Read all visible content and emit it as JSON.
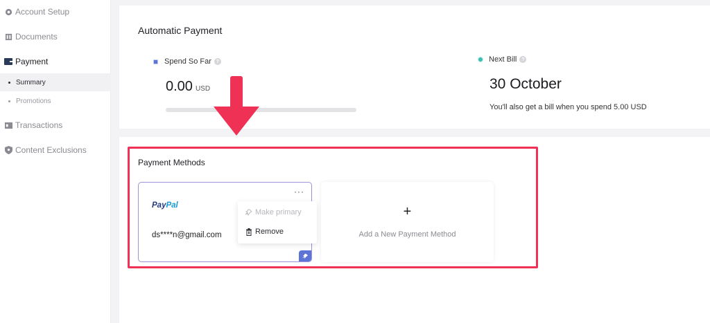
{
  "sidebar": {
    "items": [
      {
        "label": "Account Setup",
        "icon": "gear-icon"
      },
      {
        "label": "Documents",
        "icon": "document-icon"
      },
      {
        "label": "Payment",
        "icon": "wallet-icon"
      },
      {
        "label": "Transactions",
        "icon": "transactions-icon"
      },
      {
        "label": "Content Exclusions",
        "icon": "shield-icon"
      }
    ],
    "payment_sub": [
      {
        "label": "Summary"
      },
      {
        "label": "Promotions"
      }
    ],
    "active_item": "Payment",
    "active_sub": "Summary"
  },
  "automatic_payment": {
    "title": "Automatic Payment",
    "spend": {
      "label": "Spend So Far",
      "value": "0.00",
      "currency": "USD",
      "progress_fraction": 0
    },
    "next_bill": {
      "label": "Next Bill",
      "date": "30 October",
      "note": "You'll also get a bill when you spend 5.00 USD"
    }
  },
  "payment_methods": {
    "title": "Payment Methods",
    "paypal": {
      "brand_part1": "Pay",
      "brand_part2": "Pal",
      "email": "ds****n@gmail.com",
      "more_label": "···"
    },
    "menu": {
      "make_primary": "Make primary",
      "remove": "Remove"
    },
    "add_new": {
      "plus": "+",
      "label": "Add a New Payment Method"
    }
  },
  "colors": {
    "highlight": "#ef3156",
    "arrow": "#ef3156",
    "spend_marker": "#5b74d6",
    "next_bill_marker": "#3bbfb2",
    "card_border": "#9a93d8"
  }
}
